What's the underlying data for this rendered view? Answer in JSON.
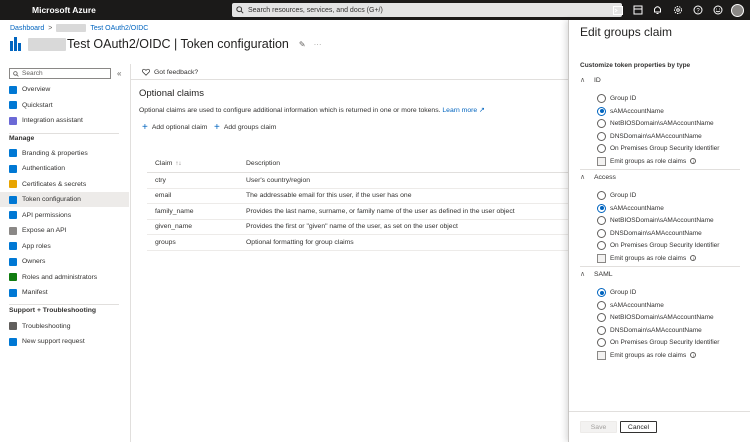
{
  "topbar": {
    "brand": "Microsoft Azure",
    "search_placeholder": "Search resources, services, and docs (G+/)",
    "icons": [
      "cloud-shell-icon",
      "directory-icon",
      "bell-icon",
      "settings-icon",
      "help-icon",
      "feedback-icon"
    ]
  },
  "breadcrumb": {
    "home": "Dashboard",
    "separator": ">",
    "current": "Test OAuth2/OIDC"
  },
  "header": {
    "title": "Test OAuth2/OIDC | Token configuration",
    "more": "···"
  },
  "sidebar": {
    "search_placeholder": "Search",
    "collapse": "«",
    "top_items": [
      {
        "label": "Overview",
        "color": "#0078d4"
      },
      {
        "label": "Quickstart",
        "color": "#0078d4"
      },
      {
        "label": "Integration assistant",
        "color": "#6b69d6"
      }
    ],
    "manage_title": "Manage",
    "manage_items": [
      {
        "label": "Branding & properties",
        "color": "#0078d4"
      },
      {
        "label": "Authentication",
        "color": "#0078d4"
      },
      {
        "label": "Certificates & secrets",
        "color": "#e8a400"
      },
      {
        "label": "Token configuration",
        "color": "#0078d4",
        "selected": true
      },
      {
        "label": "API permissions",
        "color": "#0078d4"
      },
      {
        "label": "Expose an API",
        "color": "#8a8886"
      },
      {
        "label": "App roles",
        "color": "#0078d4"
      },
      {
        "label": "Owners",
        "color": "#0078d4"
      },
      {
        "label": "Roles and administrators",
        "color": "#107c10"
      },
      {
        "label": "Manifest",
        "color": "#0078d4"
      }
    ],
    "support_title": "Support + Troubleshooting",
    "support_items": [
      {
        "label": "Troubleshooting",
        "color": "#605e5c"
      },
      {
        "label": "New support request",
        "color": "#0078d4"
      }
    ]
  },
  "main": {
    "feedback": "Got feedback?",
    "section_title": "Optional claims",
    "description": "Optional claims are used to configure additional information which is returned in one or more tokens.",
    "learn_more": "Learn more",
    "add_optional_claim": "Add optional claim",
    "add_groups_claim": "Add groups claim",
    "table": {
      "headers": [
        "Claim",
        "Description"
      ],
      "sort_icon": "↑↓",
      "rows": [
        [
          "ctry",
          "User's country/region"
        ],
        [
          "email",
          "The addressable email for this user, if the user has one"
        ],
        [
          "family_name",
          "Provides the last name, surname, or family name of the user as defined in the user object"
        ],
        [
          "given_name",
          "Provides the first or \"given\" name of the user, as set on the user object"
        ],
        [
          "groups",
          "Optional formatting for group claims"
        ]
      ]
    }
  },
  "panel": {
    "title": "Edit groups claim",
    "subtitle": "Customize token properties by type",
    "groups": [
      {
        "name": "ID",
        "options": [
          "Group ID",
          "sAMAccountName",
          "NetBIOSDomain\\sAMAccountName",
          "DNSDomain\\sAMAccountName",
          "On Premises Group Security Identifier"
        ],
        "selected": 1,
        "checkbox": "Emit groups as role claims"
      },
      {
        "name": "Access",
        "options": [
          "Group ID",
          "sAMAccountName",
          "NetBIOSDomain\\sAMAccountName",
          "DNSDomain\\sAMAccountName",
          "On Premises Group Security Identifier"
        ],
        "selected": 1,
        "checkbox": "Emit groups as role claims"
      },
      {
        "name": "SAML",
        "options": [
          "Group ID",
          "sAMAccountName",
          "NetBIOSDomain\\sAMAccountName",
          "DNSDomain\\sAMAccountName",
          "On Premises Group Security Identifier"
        ],
        "selected": 0,
        "checkbox": "Emit groups as role claims"
      }
    ],
    "save": "Save",
    "cancel": "Cancel"
  }
}
